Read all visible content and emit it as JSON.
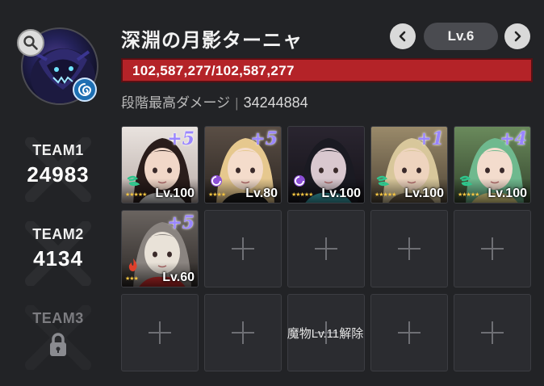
{
  "boss": {
    "name": "深淵の月影ターニャ",
    "level": "Lv.6",
    "hp_text": "102,587,277/102,587,277",
    "hp_fraction": 1.0,
    "best_damage_label": "段階最高ダメージ",
    "best_damage_value": "34244884"
  },
  "teams": [
    {
      "name": "TEAM1",
      "power": "24983",
      "locked": false
    },
    {
      "name": "TEAM2",
      "power": "4134",
      "locked": false
    },
    {
      "name": "TEAM3",
      "power": "",
      "locked": true
    }
  ],
  "team1_members": [
    {
      "plus": "+5",
      "level": "Lv.100",
      "element": "wind",
      "stars": "★★★★★",
      "art": "dark-hair-glasses"
    },
    {
      "plus": "+5",
      "level": "Lv.80",
      "element": "purple",
      "stars": "★★★★",
      "art": "blonde-nun"
    },
    {
      "plus": "",
      "level": "Lv.100",
      "element": "purple",
      "stars": "★★★★★",
      "art": "hooded-dark"
    },
    {
      "plus": "+1",
      "level": "Lv.100",
      "element": "wind",
      "stars": "★★★★★",
      "art": "blonde-male"
    },
    {
      "plus": "+4",
      "level": "Lv.100",
      "element": "wind",
      "stars": "★★★★★",
      "art": "green-hair-flowers"
    }
  ],
  "team2_members": [
    {
      "plus": "+5",
      "level": "Lv.60",
      "element": "fire",
      "stars": "★★★",
      "art": "skull-helmet"
    }
  ],
  "team3_unlock_text": "魔物Lv.11解除",
  "icons": {
    "search": "search-icon",
    "boss_element": "water-swirl-icon",
    "prev": "chevron-left-icon",
    "next": "chevron-right-icon",
    "lock": "lock-icon",
    "add": "plus-icon"
  },
  "colors": {
    "background": "#222326",
    "hp_bar": "#a01d22",
    "plus_level": "#9a86ff",
    "wind_element": "#2fc58c",
    "purple_element": "#8c4fd6",
    "fire_element": "#e0402b"
  }
}
